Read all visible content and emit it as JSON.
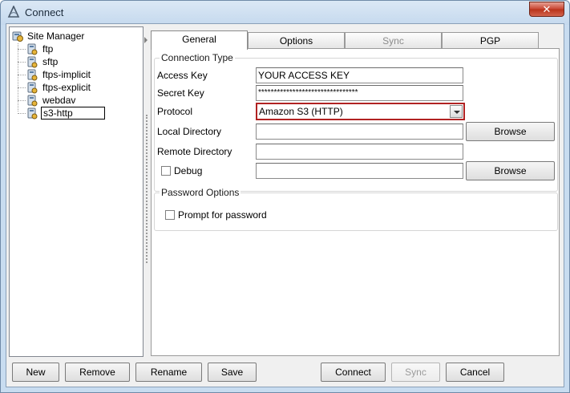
{
  "window": {
    "title": "Connect",
    "close_glyph": "✕"
  },
  "tree": {
    "root_label": "Site Manager",
    "items": [
      {
        "label": "ftp"
      },
      {
        "label": "sftp"
      },
      {
        "label": "ftps-implicit"
      },
      {
        "label": "ftps-explicit"
      },
      {
        "label": "webdav"
      },
      {
        "label": "s3-http",
        "selected": true
      }
    ]
  },
  "tabs": [
    {
      "label": "General",
      "active": true
    },
    {
      "label": "Options"
    },
    {
      "label": "Sync",
      "disabled": true
    },
    {
      "label": "PGP"
    }
  ],
  "connection_type": {
    "title": "Connection Type",
    "access_key": {
      "label": "Access Key",
      "value": "YOUR ACCESS KEY"
    },
    "secret_key": {
      "label": "Secret Key",
      "value": "********************************"
    },
    "protocol": {
      "label": "Protocol",
      "value": "Amazon S3 (HTTP)"
    },
    "local_directory": {
      "label": "Local Directory",
      "value": "",
      "browse_label": "Browse"
    },
    "remote_directory": {
      "label": "Remote Directory",
      "value": ""
    },
    "debug": {
      "label": "Debug",
      "checked": false,
      "value": "",
      "browse_label": "Browse"
    }
  },
  "password_options": {
    "title": "Password Options",
    "prompt_label": "Prompt for password",
    "prompt_checked": false
  },
  "buttons": {
    "new": "New",
    "remove": "Remove",
    "rename": "Rename",
    "save": "Save",
    "connect": "Connect",
    "sync": "Sync",
    "cancel": "Cancel"
  },
  "colors": {
    "focus_border": "#b12222",
    "window_frame": "#c8dcf0"
  }
}
